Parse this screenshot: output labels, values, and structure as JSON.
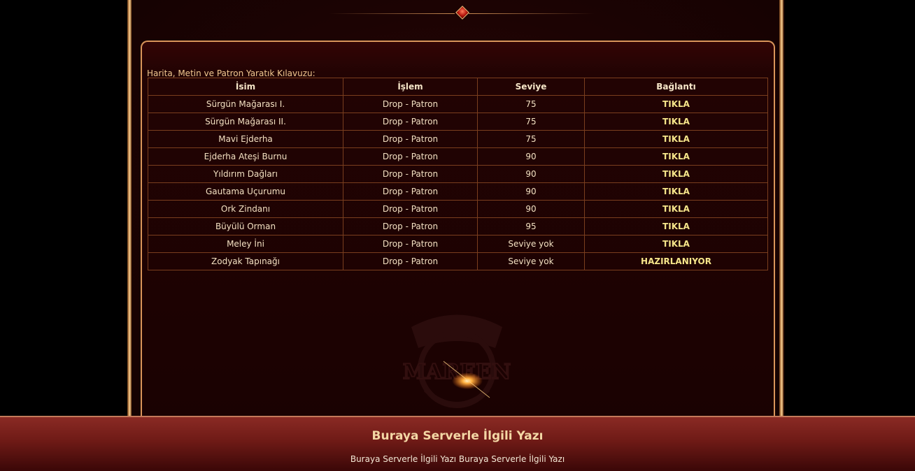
{
  "guide": {
    "title": "Harita, Metin ve Patron Yaratık Kılavuzu:",
    "columns": [
      "İsim",
      "İşlem",
      "Seviye",
      "Bağlantı"
    ],
    "rows": [
      {
        "name": "Sürgün Mağarası I.",
        "action": "Drop - Patron",
        "level": "75",
        "link": "TIKLA"
      },
      {
        "name": "Sürgün Mağarası II.",
        "action": "Drop - Patron",
        "level": "75",
        "link": "TIKLA"
      },
      {
        "name": "Mavi Ejderha",
        "action": "Drop - Patron",
        "level": "75",
        "link": "TIKLA"
      },
      {
        "name": "Ejderha Ateşi Burnu",
        "action": "Drop - Patron",
        "level": "90",
        "link": "TIKLA"
      },
      {
        "name": "Yıldırım Dağları",
        "action": "Drop - Patron",
        "level": "90",
        "link": "TIKLA"
      },
      {
        "name": "Gautama Uçurumu",
        "action": "Drop - Patron",
        "level": "90",
        "link": "TIKLA"
      },
      {
        "name": "Ork Zindanı",
        "action": "Drop - Patron",
        "level": "90",
        "link": "TIKLA"
      },
      {
        "name": "Büyülü Orman",
        "action": "Drop - Patron",
        "level": "95",
        "link": "TIKLA"
      },
      {
        "name": "Meley İni",
        "action": "Drop - Patron",
        "level": "Seviye yok",
        "link": "TIKLA"
      },
      {
        "name": "Zodyak Tapınağı",
        "action": "Drop - Patron",
        "level": "Seviye yok",
        "link": "HAZIRLANIYOR"
      }
    ]
  },
  "watermark": {
    "text": "MAREEN"
  },
  "footer": {
    "title": "Buraya Serverle İlgili Yazı",
    "text": "Buraya Serverle İlgili Yazı Buraya Serverle İlgili Yazı"
  },
  "colors": {
    "background": "#000000",
    "panel": "#1c0303",
    "border_gold": "#d9955a",
    "link_yellow": "#f5e58a",
    "footer_red": "#7a201c"
  }
}
